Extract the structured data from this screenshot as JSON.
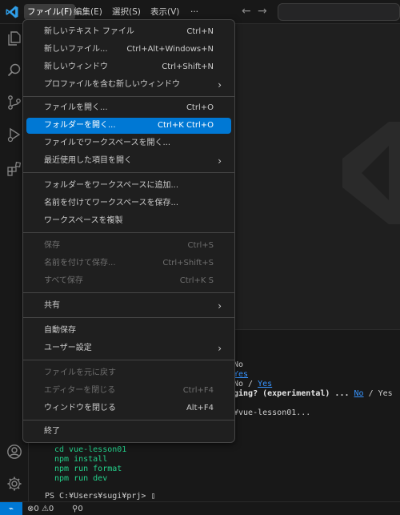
{
  "menubar": {
    "items": [
      {
        "label": "ファイル(F)",
        "active": true
      },
      {
        "label": "編集(E)"
      },
      {
        "label": "選択(S)"
      },
      {
        "label": "表示(V)"
      },
      {
        "label": "···"
      }
    ],
    "back": "←",
    "forward": "→"
  },
  "file_menu": {
    "items": [
      {
        "label": "新しいテキスト ファイル",
        "shortcut": "Ctrl+N"
      },
      {
        "label": "新しいファイル...",
        "shortcut": "Ctrl+Alt+Windows+N"
      },
      {
        "label": "新しいウィンドウ",
        "shortcut": "Ctrl+Shift+N"
      },
      {
        "label": "プロファイルを含む新しいウィンドウ",
        "submenu": true
      },
      {
        "label": "ファイルを開く...",
        "shortcut": "Ctrl+O"
      },
      {
        "label": "フォルダーを開く...",
        "shortcut": "Ctrl+K Ctrl+O",
        "selected": true
      },
      {
        "label": "ファイルでワークスペースを開く..."
      },
      {
        "label": "最近使用した項目を開く",
        "submenu": true
      },
      {
        "label": "フォルダーをワークスペースに追加..."
      },
      {
        "label": "名前を付けてワークスペースを保存..."
      },
      {
        "label": "ワークスペースを複製"
      },
      {
        "label": "保存",
        "shortcut": "Ctrl+S",
        "disabled": true
      },
      {
        "label": "名前を付けて保存...",
        "shortcut": "Ctrl+Shift+S",
        "disabled": true
      },
      {
        "label": "すべて保存",
        "shortcut": "Ctrl+K S",
        "disabled": true
      },
      {
        "label": "共有",
        "submenu": true
      },
      {
        "label": "自動保存"
      },
      {
        "label": "ユーザー設定",
        "submenu": true
      },
      {
        "label": "ファイルを元に戻す",
        "disabled": true
      },
      {
        "label": "エディターを閉じる",
        "shortcut": "Ctrl+F4",
        "disabled": true
      },
      {
        "label": "ウィンドウを閉じる",
        "shortcut": "Alt+F4"
      },
      {
        "label": "終了"
      }
    ]
  },
  "terminal": {
    "partial_no_1": "No",
    "partial_yes_1": "Yes",
    "partial_no_2": "No / ",
    "partial_yes_2": "Yes",
    "debug_prompt": "ging? (experimental) ... ",
    "debug_no": "No",
    "debug_sep": " / Yes",
    "scaffold": "¥vue-lesson01...",
    "cmd_cd": "cd vue-lesson01",
    "cmd_install": "npm install",
    "cmd_format": "npm run format",
    "cmd_dev": "npm run dev",
    "prompt": "PS C:¥Users¥sugi¥prj> ▯"
  },
  "statusbar": {
    "remote_icon": "⌁",
    "errors": "0",
    "warnings": "0",
    "ports": "0"
  },
  "colors": {
    "accent": "#0078d4",
    "link": "#3794ff",
    "green": "#23d18b"
  }
}
